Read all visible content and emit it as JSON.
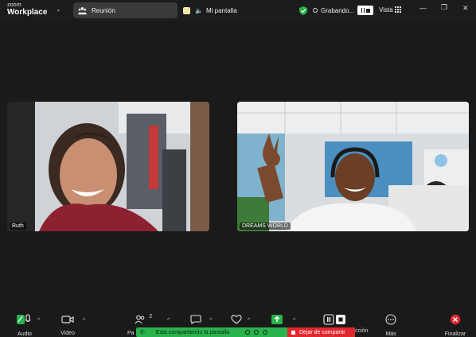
{
  "app": {
    "logo_top": "zoom",
    "logo_bottom": "Workplace"
  },
  "tabs": {
    "meeting_label": "Reunión",
    "screen_label": "Mi pantalla"
  },
  "recording": {
    "label": "Grabando..."
  },
  "view": {
    "label": "Vista"
  },
  "participants": [
    {
      "name": "Ruth"
    },
    {
      "name": "DREAMS WORLD"
    }
  ],
  "toolbar": {
    "audio": "Audio",
    "video": "Video",
    "participants_count": "2",
    "participants_partial": "Pa",
    "reactions_partial": "cción",
    "more": "Más",
    "end": "Finalizar"
  },
  "share_banner": {
    "status": "Está compartiendo la pantalla",
    "stop": "Dejar de compartir"
  },
  "colors": {
    "accent_green": "#2ab24d",
    "stop_red": "#e0282e",
    "end_red": "#e0282e"
  }
}
